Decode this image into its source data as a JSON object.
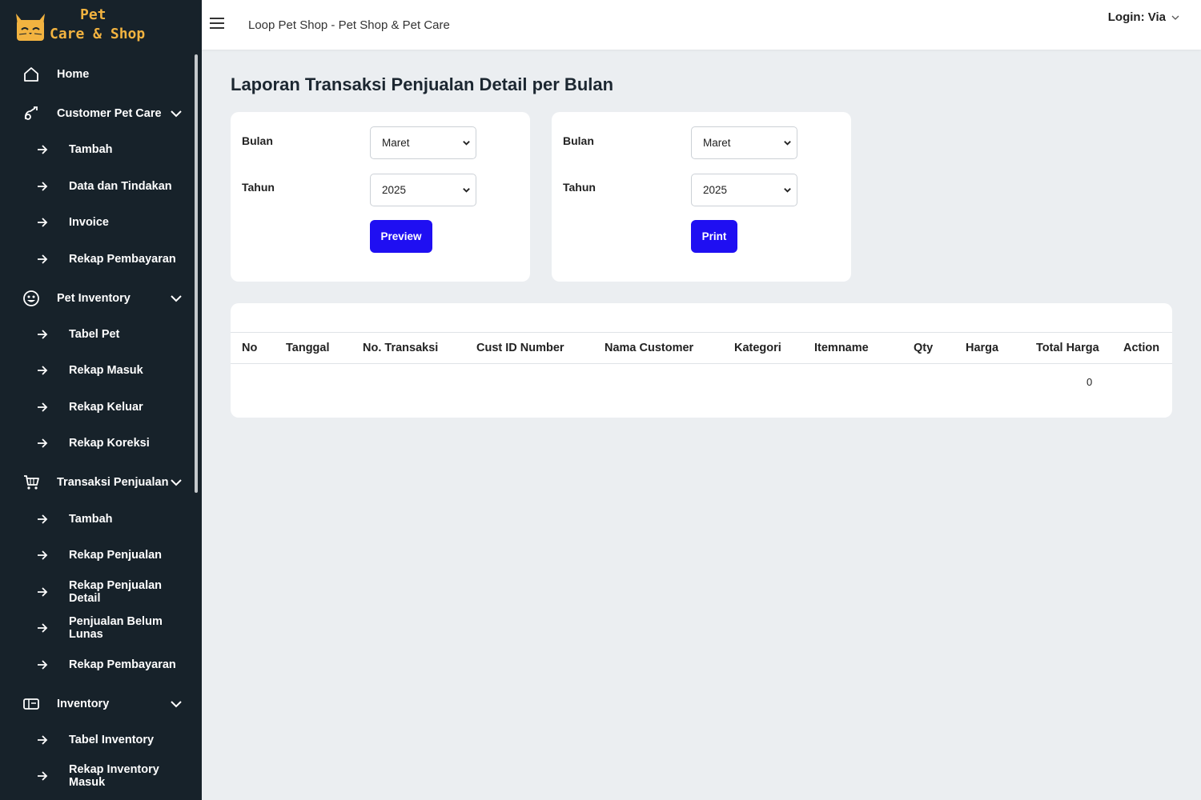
{
  "logo": {
    "line1": "Pet",
    "line2": "Care & Shop"
  },
  "sidebar": {
    "items": [
      {
        "label": "Home",
        "icon": "home-icon",
        "type": "main"
      },
      {
        "label": "Customer Pet Care",
        "icon": "pet-care-icon",
        "type": "group"
      },
      {
        "label": "Tambah",
        "type": "sub"
      },
      {
        "label": "Data dan Tindakan",
        "type": "sub"
      },
      {
        "label": "Invoice",
        "type": "sub"
      },
      {
        "label": "Rekap Pembayaran",
        "type": "sub"
      },
      {
        "label": "Pet Inventory",
        "icon": "smiley-icon",
        "type": "group"
      },
      {
        "label": "Tabel Pet",
        "type": "sub"
      },
      {
        "label": "Rekap Masuk",
        "type": "sub"
      },
      {
        "label": "Rekap Keluar",
        "type": "sub"
      },
      {
        "label": "Rekap Koreksi",
        "type": "sub"
      },
      {
        "label": "Transaksi Penjualan",
        "icon": "cart-icon",
        "type": "group"
      },
      {
        "label": "Tambah",
        "type": "sub"
      },
      {
        "label": "Rekap Penjualan",
        "type": "sub"
      },
      {
        "label": "Rekap Penjualan Detail",
        "type": "sub"
      },
      {
        "label": "Penjualan Belum Lunas",
        "type": "sub"
      },
      {
        "label": "Rekap Pembayaran",
        "type": "sub"
      },
      {
        "label": "Inventory",
        "icon": "inventory-icon",
        "type": "group"
      },
      {
        "label": "Tabel Inventory",
        "type": "sub"
      },
      {
        "label": "Rekap Inventory Masuk",
        "type": "sub"
      }
    ]
  },
  "topbar": {
    "title": "Loop Pet Shop - Pet Shop & Pet Care",
    "login": "Login: Via"
  },
  "page_title": "Laporan Transaksi Penjualan Detail per Bulan",
  "preview_form": {
    "bulan_label": "Bulan",
    "bulan_value": "Maret",
    "tahun_label": "Tahun",
    "tahun_value": "2025",
    "button": "Preview"
  },
  "print_form": {
    "bulan_label": "Bulan",
    "bulan_value": "Maret",
    "tahun_label": "Tahun",
    "tahun_value": "2025",
    "button": "Print"
  },
  "table": {
    "columns": [
      "No",
      "Tanggal",
      "No. Transaksi",
      "Cust ID Number",
      "Nama Customer",
      "Kategori",
      "Itemname",
      "Qty",
      "Harga",
      "Total Harga",
      "Action"
    ],
    "total": "0"
  },
  "colors": {
    "sidebar_bg": "#17222a",
    "accent_button": "#1f0ff2",
    "page_bg": "#ebeef1",
    "logo_text": "#f2b340"
  }
}
